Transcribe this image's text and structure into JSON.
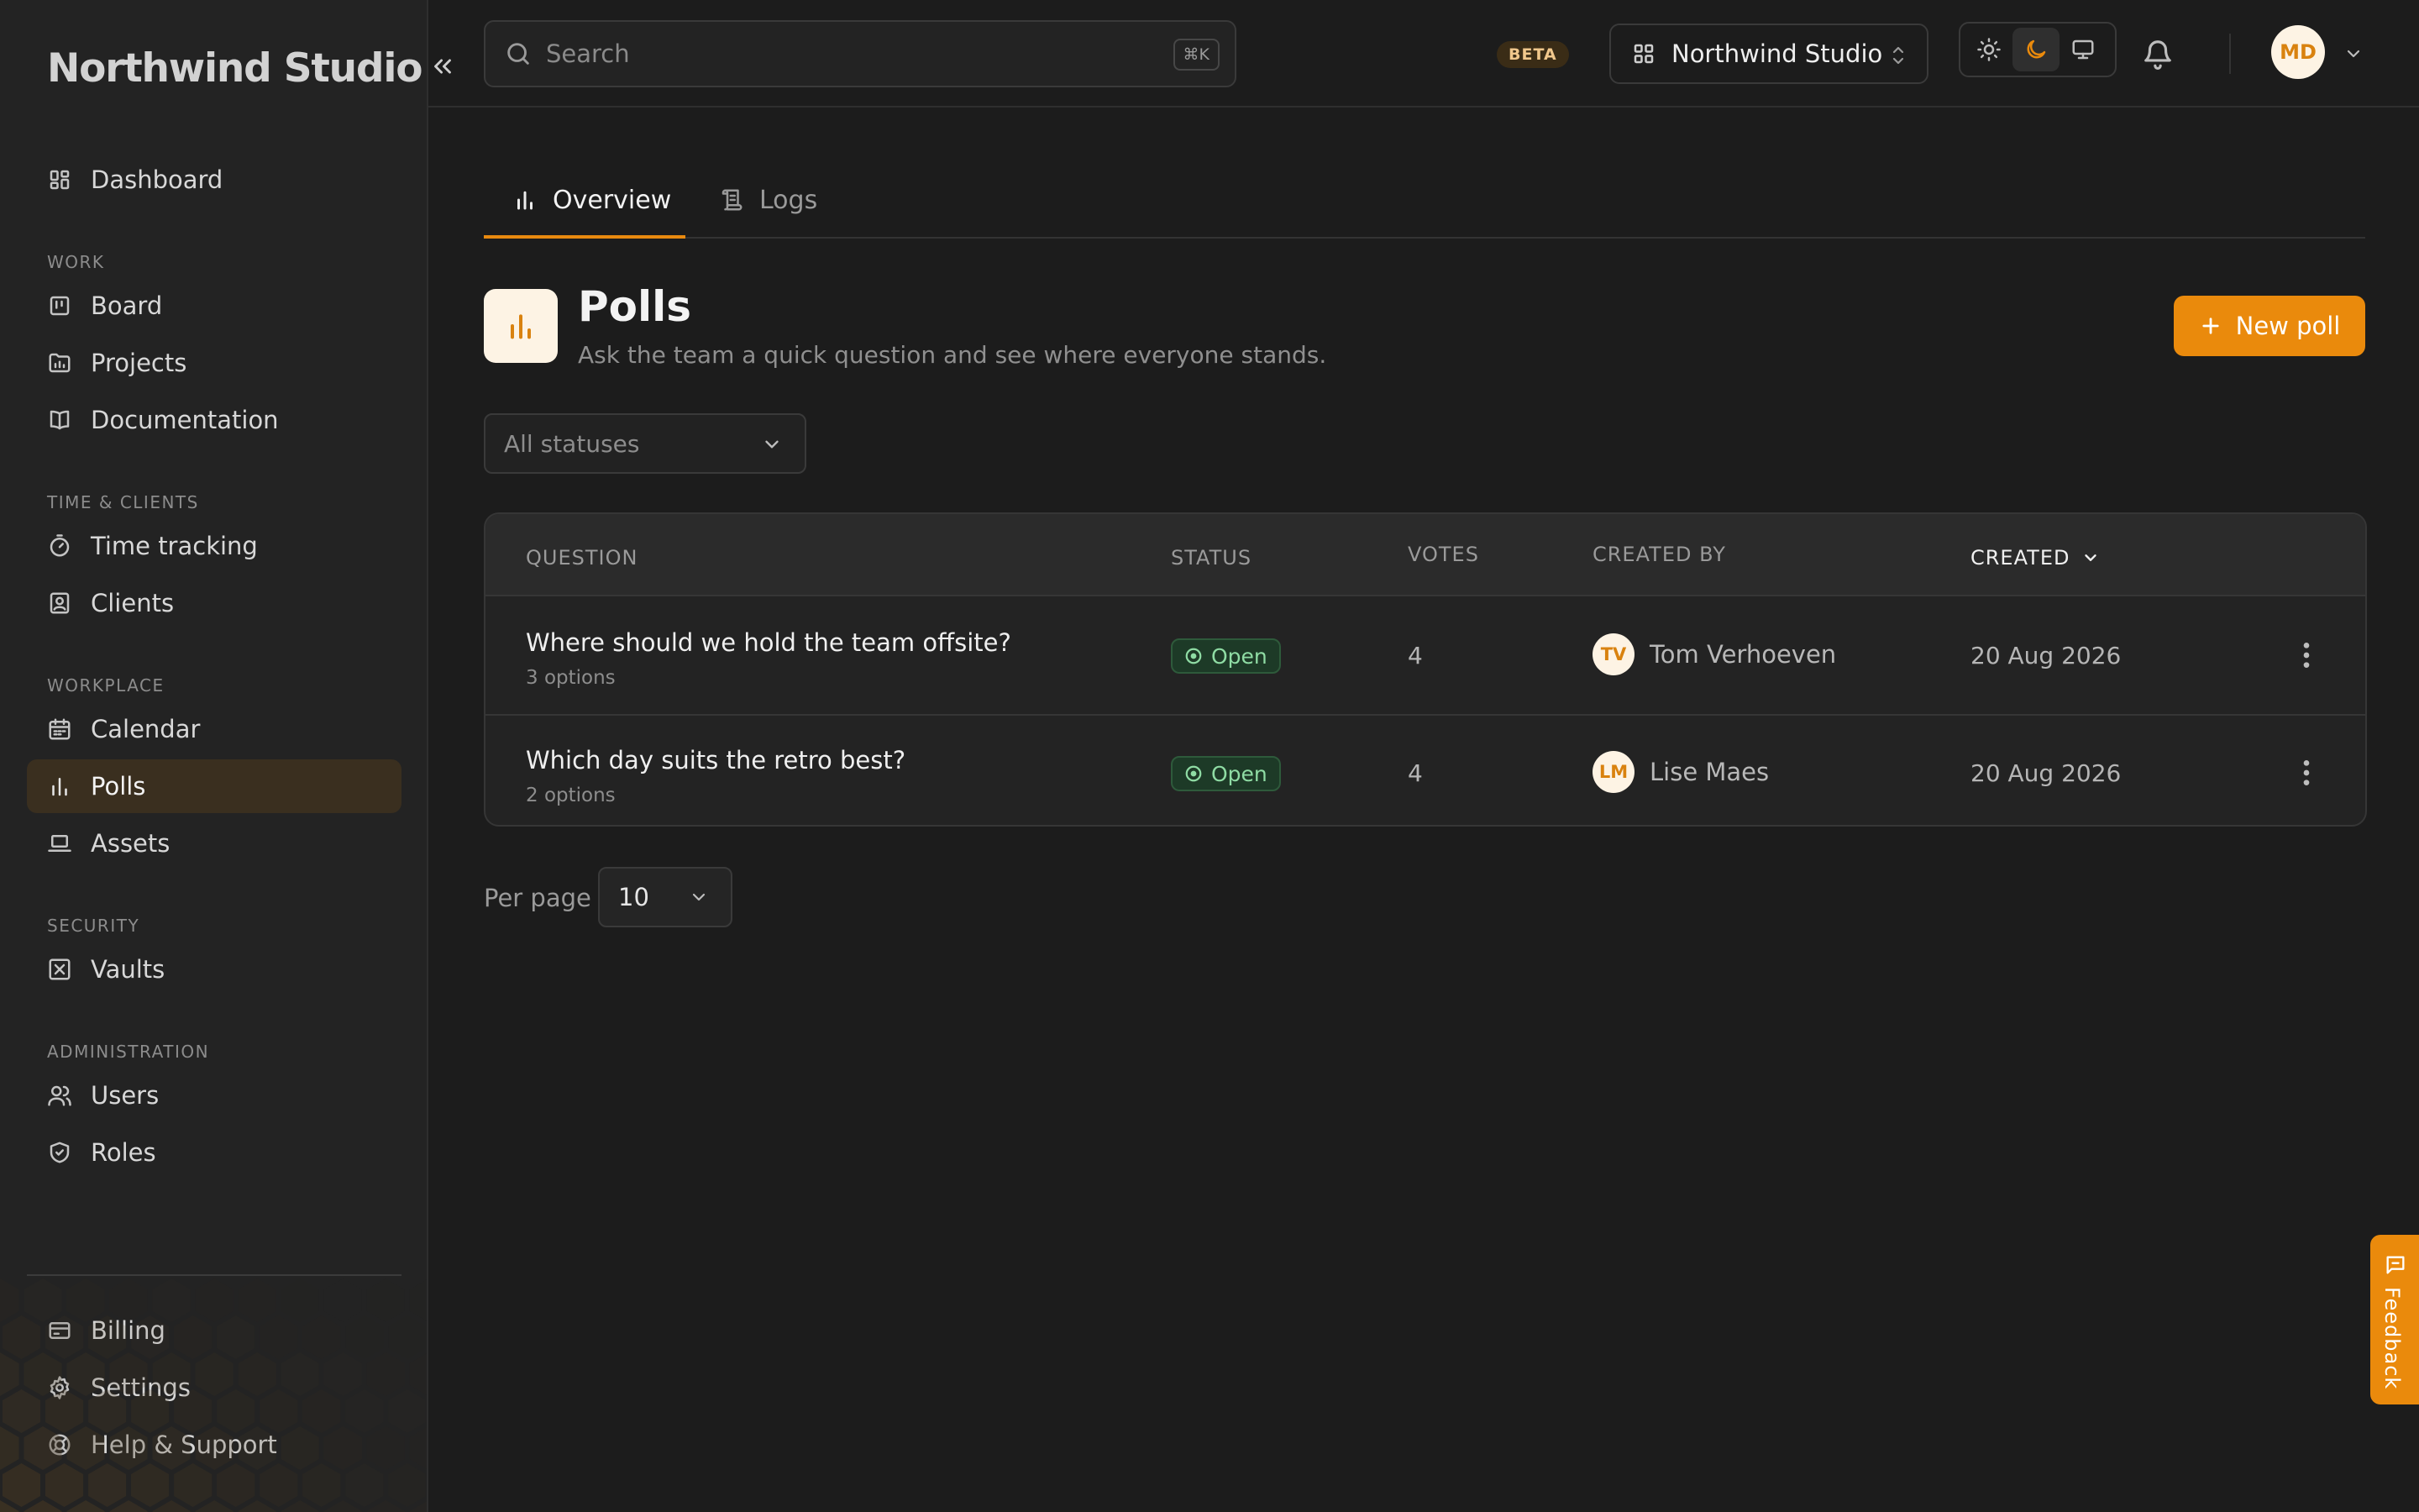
{
  "brand": {
    "name": "Northwind Studio"
  },
  "sidebar": {
    "top_items": [
      {
        "label": "Dashboard",
        "icon": "dashboard-icon"
      }
    ],
    "sections": [
      {
        "title": "WORK",
        "items": [
          {
            "label": "Board",
            "icon": "board-icon"
          },
          {
            "label": "Projects",
            "icon": "folder-icon"
          },
          {
            "label": "Documentation",
            "icon": "book-icon"
          }
        ]
      },
      {
        "title": "TIME & CLIENTS",
        "items": [
          {
            "label": "Time tracking",
            "icon": "timer-icon"
          },
          {
            "label": "Clients",
            "icon": "contact-icon"
          }
        ]
      },
      {
        "title": "WORKPLACE",
        "items": [
          {
            "label": "Calendar",
            "icon": "calendar-icon"
          },
          {
            "label": "Polls",
            "icon": "bar-chart-icon",
            "active": true
          },
          {
            "label": "Assets",
            "icon": "laptop-icon"
          }
        ]
      },
      {
        "title": "SECURITY",
        "items": [
          {
            "label": "Vaults",
            "icon": "vault-icon"
          }
        ]
      },
      {
        "title": "ADMINISTRATION",
        "items": [
          {
            "label": "Users",
            "icon": "users-icon"
          },
          {
            "label": "Roles",
            "icon": "shield-icon"
          }
        ]
      }
    ],
    "bottom_items": [
      {
        "label": "Billing",
        "icon": "credit-card-icon"
      },
      {
        "label": "Settings",
        "icon": "gear-icon"
      },
      {
        "label": "Help & Support",
        "icon": "lifebuoy-icon"
      }
    ]
  },
  "topbar": {
    "search_placeholder": "Search",
    "search_shortcut": "⌘K",
    "badge": "BETA",
    "workspace": "Northwind Studio",
    "user_initials": "MD"
  },
  "tabs": [
    {
      "label": "Overview",
      "icon": "bar-chart-icon",
      "active": true
    },
    {
      "label": "Logs",
      "icon": "scroll-icon"
    }
  ],
  "page": {
    "title": "Polls",
    "subtitle": "Ask the team a quick question and see where everyone stands.",
    "new_button": "New poll"
  },
  "filter": {
    "selected": "All statuses"
  },
  "table": {
    "columns": [
      "QUESTION",
      "STATUS",
      "VOTES",
      "CREATED BY",
      "CREATED"
    ],
    "sort_column": "CREATED",
    "rows": [
      {
        "question": "Where should we hold the team offsite?",
        "options": "3 options",
        "status": "Open",
        "votes": "4",
        "creator": "Tom Verhoeven",
        "initials": "TV",
        "created": "20 Aug 2026"
      },
      {
        "question": "Which day suits the retro best?",
        "options": "2 options",
        "status": "Open",
        "votes": "4",
        "creator": "Lise Maes",
        "initials": "LM",
        "created": "20 Aug 2026"
      }
    ]
  },
  "pagination": {
    "label": "Per page",
    "value": "10"
  },
  "feedback": {
    "label": "Feedback"
  },
  "colors": {
    "accent": "#ea8a0c",
    "background": "#1c1c1c",
    "sidebar": "#232323",
    "status_open": "#8fdca4"
  }
}
